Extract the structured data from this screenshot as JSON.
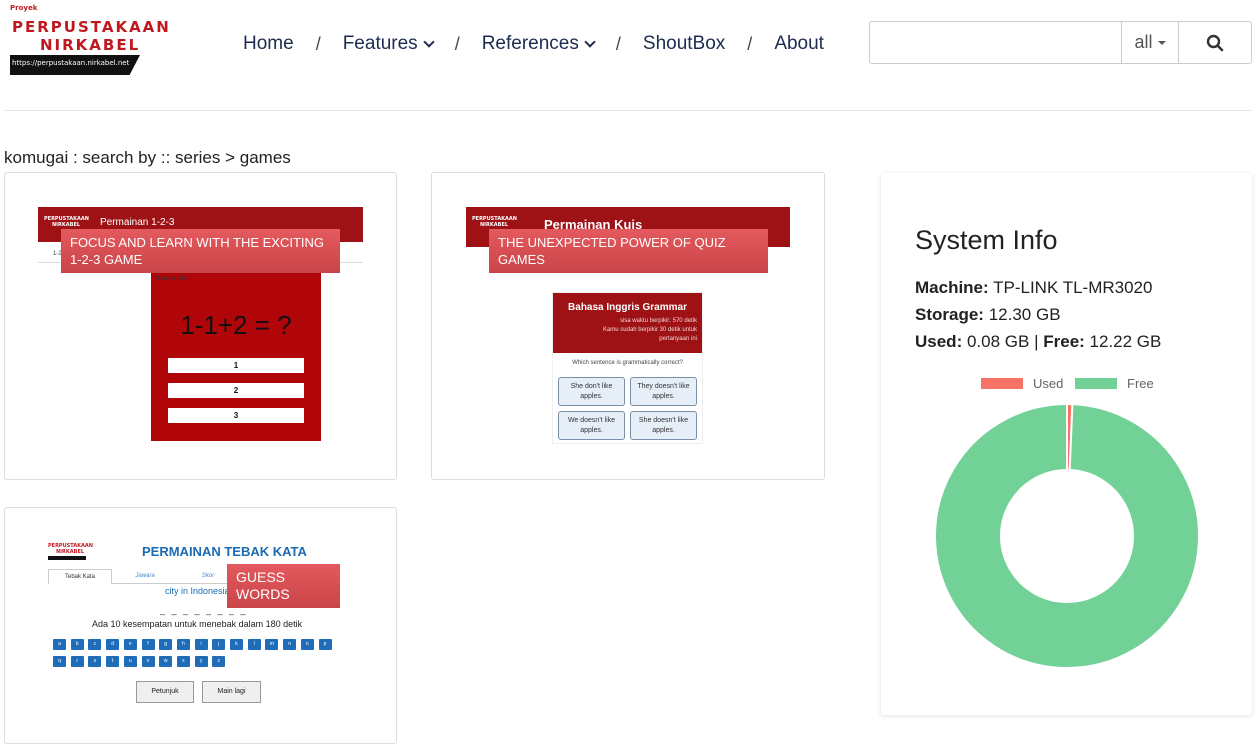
{
  "logo": {
    "kicker": "Proyek",
    "line1": "PERPUSTAKAAN",
    "line2": "NIRKABEL",
    "url": "https://perpustakaan.nirkabel.net"
  },
  "nav": {
    "home": "Home",
    "features": "Features",
    "references": "References",
    "shoutbox": "ShoutBox",
    "about": "About",
    "separator": "/"
  },
  "search": {
    "value": "",
    "scope": "all",
    "icon": "search-icon"
  },
  "breadcrumb": "komugai : search by :: series > games",
  "cards": [
    {
      "label": "FOCUS AND LEARN WITH THE EXCITING 1-2-3 GAME",
      "header_title": "Permainan 1-2-3",
      "logo_line1": "PERPUSTAKAAN",
      "logo_line2": "NIRKABEL",
      "level": "Nilai/no: 428",
      "equation": "1-1+2 = ?",
      "options": [
        "1",
        "2",
        "3"
      ],
      "edge_text": "1-2"
    },
    {
      "label": "THE UNEXPECTED POWER OF QUIZ GAMES",
      "header_title": "Permainan Kuis",
      "logo_line1": "PERPUSTAKAAN",
      "logo_line2": "NIRKABEL",
      "quiz_title": "Bahasa Inggris Grammar",
      "quiz_sub1": "sisa waktu berpikir: 570 detik",
      "quiz_sub2": "Kamu sudah berpikir 30 detik untuk",
      "quiz_sub3": "pertanyaan ini",
      "question": "Which sentence is grammatically correct?",
      "answers": [
        "She don't like apples.",
        "They doesn't like apples.",
        "We doesn't like apples.",
        "She doesn't like apples."
      ]
    },
    {
      "label": "GUESS WORDS",
      "title": "PERMAINAN TEBAK KATA",
      "logo_line1": "PERPUSTAKAAN",
      "logo_line2": "NIRKABEL",
      "tabs": [
        "Tebak Kata",
        "Jawara",
        "Skor"
      ],
      "hint": "city in Indonesia",
      "dashes": "_ _ _ _ _ _ _ _",
      "chance": "Ada 10 kesempatan untuk menebak dalam 180 detik",
      "keys_row1": [
        "a",
        "b",
        "c",
        "d",
        "e",
        "f",
        "g",
        "h",
        "i",
        "j",
        "k",
        "l",
        "m",
        "n",
        "o",
        "p"
      ],
      "keys_row2": [
        "q",
        "r",
        "s",
        "t",
        "u",
        "v",
        "w",
        "x",
        "y",
        "z"
      ],
      "btn_hint": "Petunjuk",
      "btn_again": "Main lagi"
    }
  ],
  "system": {
    "title": "System Info",
    "machine_label": "Machine:",
    "machine": "TP-LINK TL-MR3020",
    "storage_label": "Storage:",
    "storage": "12.30 GB",
    "used_label": "Used:",
    "used": "0.08 GB",
    "free_label": "Free:",
    "free": "12.22 GB",
    "divider": "|"
  },
  "chart_data": {
    "type": "pie",
    "variant": "doughnut",
    "legend_position": "top",
    "series": [
      {
        "name": "Used",
        "value": 0.08,
        "color": "#f87267"
      },
      {
        "name": "Free",
        "value": 12.22,
        "color": "#72d197"
      }
    ]
  }
}
